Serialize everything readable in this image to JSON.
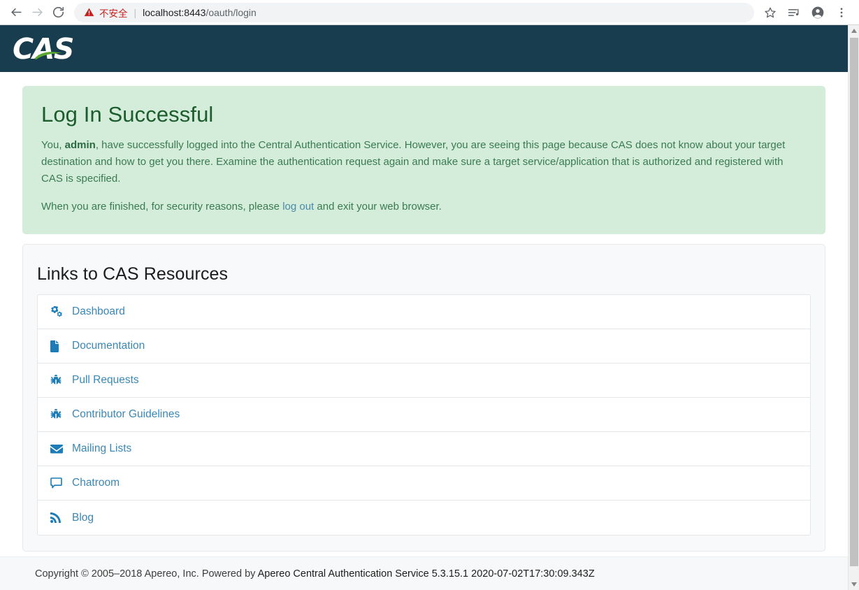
{
  "browser": {
    "back_label": "back-arrow",
    "forward_label": "forward-arrow",
    "reload_label": "reload",
    "security_status": "不安全",
    "url_host": "localhost:8443",
    "url_path": "/oauth/login",
    "separator": "|",
    "icons": {
      "bookmark": "star-icon",
      "reading_list": "media-queue-icon",
      "profile": "profile-avatar-icon",
      "menu": "three-dot-menu-icon"
    }
  },
  "site": {
    "logo_text": "CAS",
    "logo_accent_color": "#5aa832",
    "header_bg": "#183d4e"
  },
  "alert": {
    "heading": "Log In Successful",
    "paragraph1_pre": "You, ",
    "paragraph1_user": "admin",
    "paragraph1_post": ", have successfully logged into the Central Authentication Service. However, you are seeing this page because CAS does not know about your target destination and how to get you there. Examine the authentication request again and make sure a target service/application that is authorized and registered with CAS is specified.",
    "paragraph2_pre": "When you are finished, for security reasons, please ",
    "logout_link": "log out",
    "paragraph2_post": " and exit your web browser.",
    "bg_color": "#d4edda",
    "heading_color": "#1d5c2c",
    "link_color": "#4a89a8"
  },
  "resources": {
    "title": "Links to CAS Resources",
    "link_color": "#3a87b5",
    "items": [
      {
        "label": "Dashboard",
        "icon": "cogs-icon"
      },
      {
        "label": "Documentation",
        "icon": "file-icon"
      },
      {
        "label": "Pull Requests",
        "icon": "bug-icon"
      },
      {
        "label": "Contributor Guidelines",
        "icon": "bug-icon"
      },
      {
        "label": "Mailing Lists",
        "icon": "envelope-icon"
      },
      {
        "label": "Chatroom",
        "icon": "comment-icon"
      },
      {
        "label": "Blog",
        "icon": "rss-icon"
      }
    ]
  },
  "footer": {
    "copyright": "Copyright © 2005–2018 Apereo, Inc. Powered by ",
    "product": "Apereo Central Authentication Service 5.3.15.1 2020-07-02T17:30:09.343Z"
  }
}
